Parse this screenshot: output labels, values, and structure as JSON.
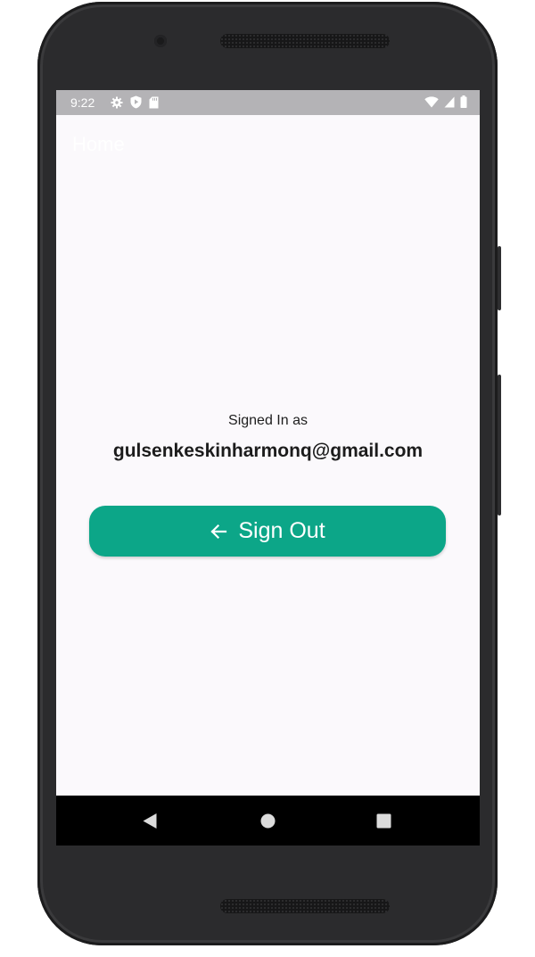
{
  "status_bar": {
    "time": "9:22",
    "icons_left": [
      "settings-icon",
      "shield-play-icon",
      "sd-card-icon"
    ],
    "icons_right": [
      "wifi-icon",
      "signal-icon",
      "battery-icon"
    ]
  },
  "app_bar": {
    "title": "Home"
  },
  "account": {
    "signed_in_label": "Signed In as",
    "email": "gulsenkeskinharmonq@gmail.com"
  },
  "sign_out": {
    "label": "Sign Out",
    "icon": "arrow-left-icon",
    "color": "#0ca688"
  },
  "nav_bar": {
    "buttons": [
      "back-icon",
      "home-icon",
      "recents-icon"
    ]
  }
}
